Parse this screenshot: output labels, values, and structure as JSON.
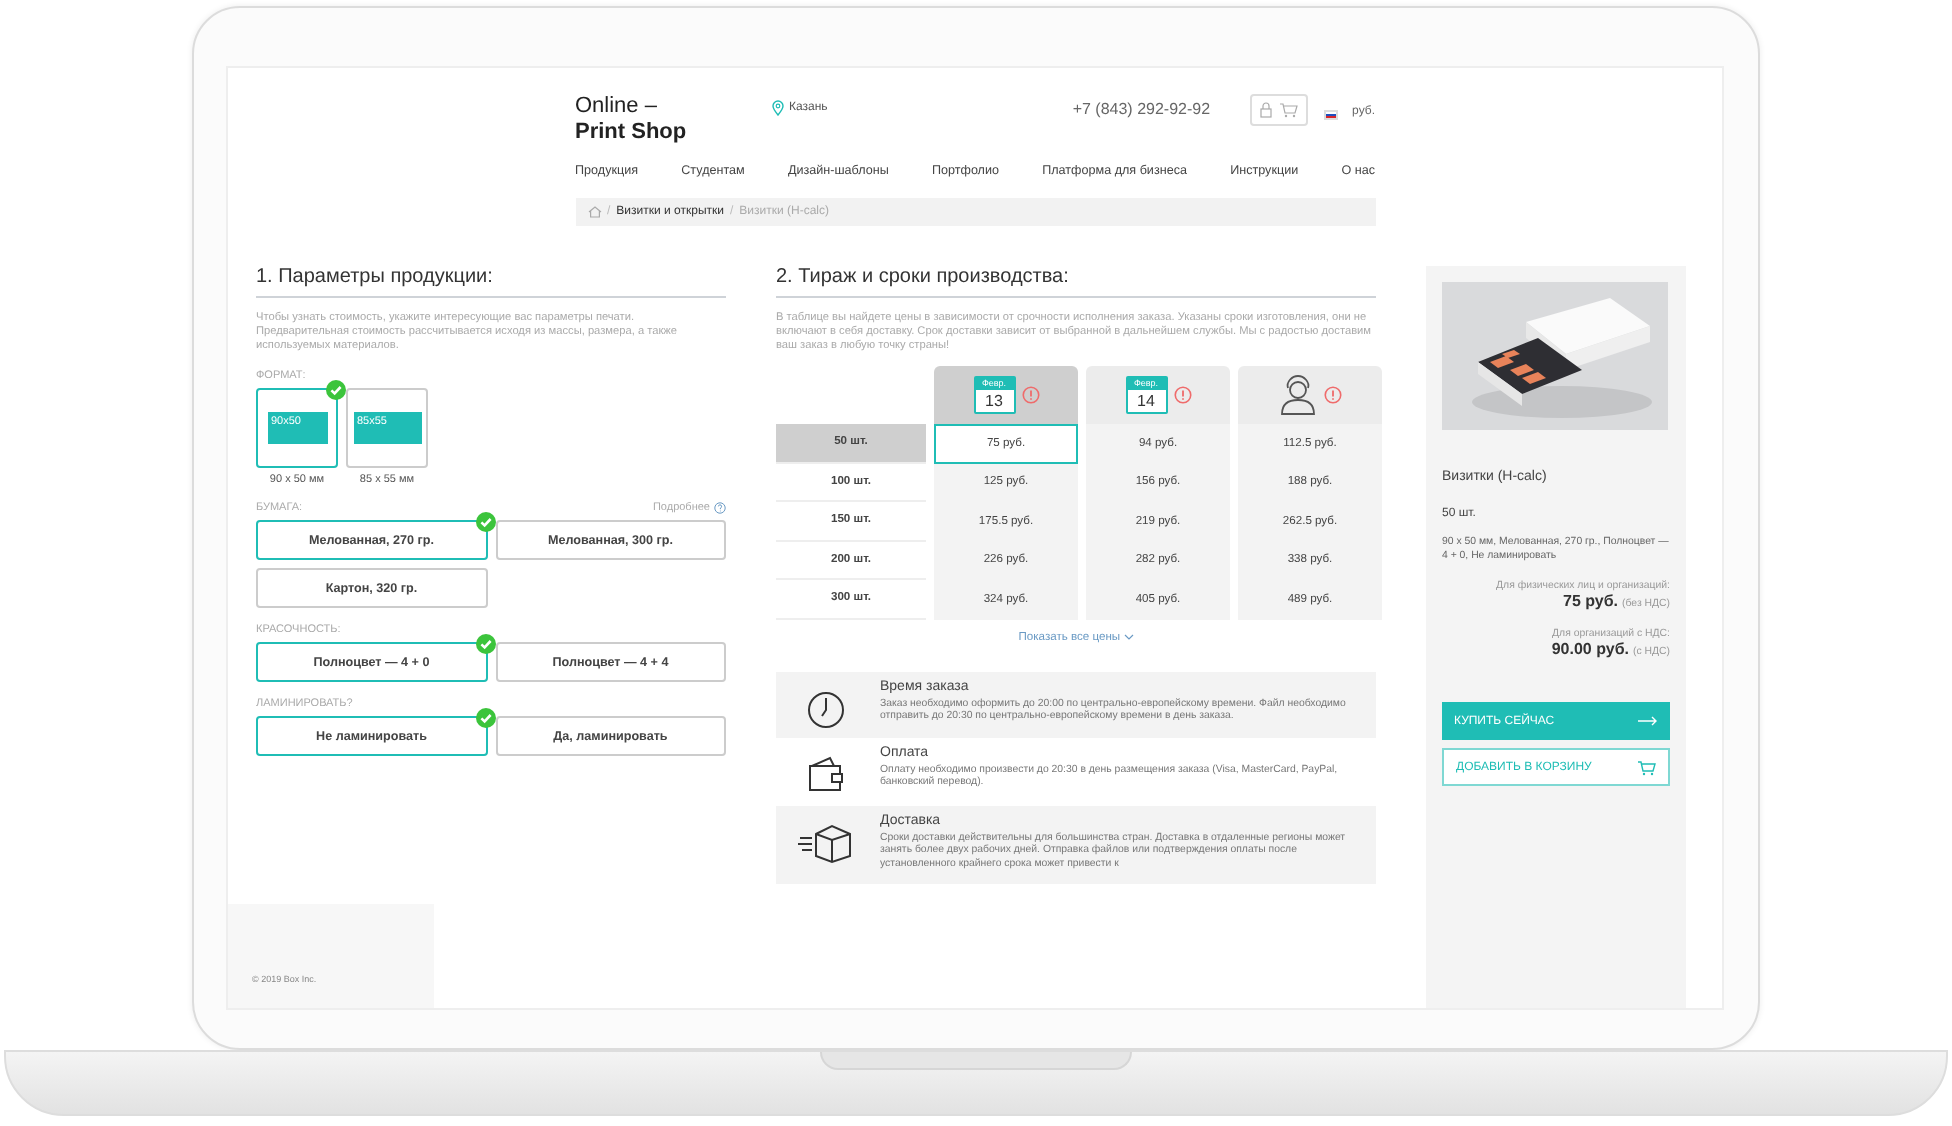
{
  "header": {
    "logo_line1": "Online –",
    "logo_line2": "Print Shop",
    "city": "Казань",
    "phone": "+7 (843) 292-92-92",
    "currency": "руб."
  },
  "nav": [
    "Продукция",
    "Студентам",
    "Дизайн-шаблоны",
    "Портфолио",
    "Платформа для бизнеса",
    "Инструкции",
    "О нас"
  ],
  "breadcrumbs": [
    {
      "separator": "/",
      "label": "Визитки и открытки",
      "current": false
    },
    {
      "separator": "/",
      "label": "Визитки (H-calc)",
      "current": true
    }
  ],
  "params": {
    "title": "1. Параметры продукции:",
    "description": "Чтобы узнать стоимость, укажите интересующие вас параметры печати. Предварительная стоимость рассчитывается исходя из массы, размера, а также используемых материалов.",
    "groups": [
      {
        "label": "ФОРМАТ:",
        "kind": "format",
        "options": [
          {
            "label": "90x50",
            "caption": "90 x 50 мм",
            "selected": true
          },
          {
            "label": "85x55",
            "caption": "85 x 55 мм",
            "selected": false
          }
        ]
      },
      {
        "label": "БУМАГА:",
        "help": "Подробнее",
        "kind": "buttons",
        "options": [
          {
            "label": "Мелованная, 270 гр.",
            "selected": true
          },
          {
            "label": "Мелованная, 300 гр.",
            "selected": false
          },
          {
            "label": "Картон, 320 гр.",
            "selected": false
          }
        ]
      },
      {
        "label": "КРАСОЧНОСТЬ:",
        "kind": "buttons",
        "options": [
          {
            "label": "Полноцвет — 4 + 0",
            "selected": true
          },
          {
            "label": "Полноцвет — 4 + 4",
            "selected": false
          }
        ]
      },
      {
        "label": "ЛАМИНИРОВАТЬ?",
        "kind": "buttons",
        "options": [
          {
            "label": "Не ламинировать",
            "selected": true
          },
          {
            "label": "Да, ламинировать",
            "selected": false
          }
        ]
      }
    ]
  },
  "footer": {
    "copyright": "© 2019 Box Inc."
  },
  "pricing": {
    "title": "2. Тираж и сроки производства:",
    "description": "В таблице вы найдете цены в зависимости от срочности исполнения заказа. Указаны сроки изготовления, они не включают в себя доставку. Срок доставки зависит от выбранной в дальнейшем службы. Мы с радостью доставим ваш заказ в любую точку страны!",
    "columns": [
      {
        "kind": "date",
        "month": "Февр.",
        "day": "13",
        "selected": true
      },
      {
        "kind": "date",
        "month": "Февр.",
        "day": "14",
        "selected": false
      },
      {
        "kind": "person",
        "selected": false
      }
    ],
    "rows": [
      {
        "quantity": "50 шт.",
        "selected": true,
        "prices": [
          "75 руб.",
          "94 руб.",
          "112.5 руб."
        ]
      },
      {
        "quantity": "100 шт.",
        "selected": false,
        "prices": [
          "125 руб.",
          "156 руб.",
          "188 руб."
        ]
      },
      {
        "quantity": "150 шт.",
        "selected": false,
        "prices": [
          "175.5 руб.",
          "219 руб.",
          "262.5 руб."
        ]
      },
      {
        "quantity": "200 шт.",
        "selected": false,
        "prices": [
          "226 руб.",
          "282 руб.",
          "338 руб."
        ]
      },
      {
        "quantity": "300 шт.",
        "selected": false,
        "prices": [
          "324 руб.",
          "405 руб.",
          "489 руб."
        ]
      }
    ],
    "show_all": "Показать все цены"
  },
  "info": [
    {
      "kind": "clock",
      "title": "Время заказа",
      "text": "Заказ необходимо оформить до 20:00 по центрально-европейскому времени. Файл необходимо отправить до 20:30 по центрально-европейскому времени в день заказа."
    },
    {
      "kind": "wallet",
      "title": "Оплата",
      "text": "Оплату необходимо произвести до 20:30 в день размещения заказа (Visa, MasterCard, PayPal, банковский перевод)."
    },
    {
      "kind": "box",
      "title": "Доставка",
      "text": "Сроки доставки действительны для большинства стран. Доставка в отдаленные регионы может занять более двух рабочих дней. Отправка файлов или подтверждения оплаты после установленного крайнего срока может привести к"
    }
  ],
  "summary": {
    "title": "Визитки (H-calc)",
    "quantity": "50 шт.",
    "details": "90 x 50 мм, Мелованная, 270 гр., Полноцвет — 4 + 0, Не ламинировать",
    "prices": [
      {
        "label": "Для физических лиц и организаций:",
        "amount": "75 руб.",
        "note": "(без НДС)"
      },
      {
        "label": "Для организаций с НДС:",
        "amount": "90.00 руб.",
        "note": "(с НДС)"
      }
    ],
    "buy": "КУПИТЬ СЕЙЧАС",
    "cart": "ДОБАВИТЬ В КОРЗИНУ"
  }
}
